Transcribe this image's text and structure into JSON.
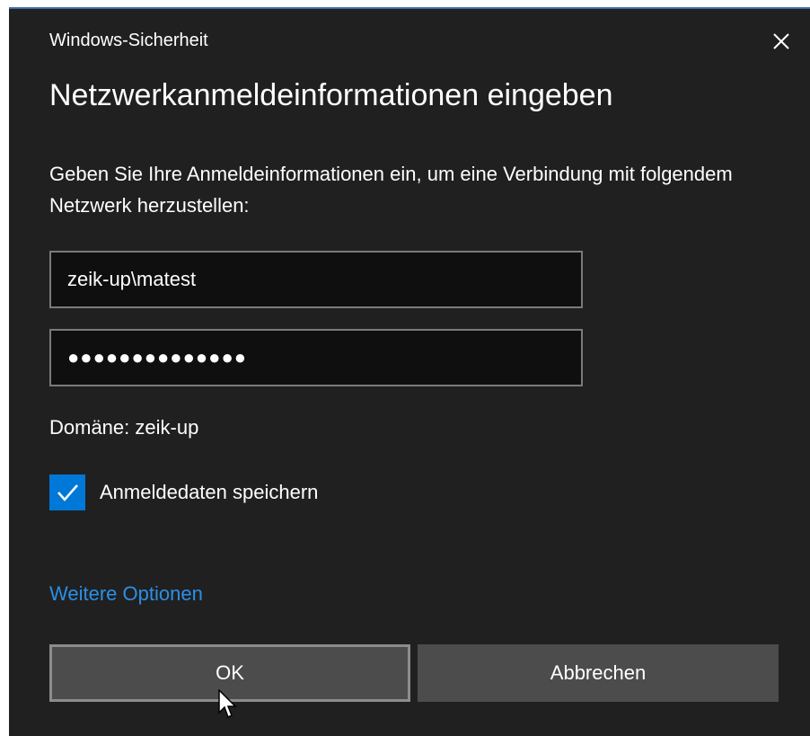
{
  "window": {
    "title": "Windows-Sicherheit",
    "close_icon": "close-icon"
  },
  "dialog": {
    "heading": "Netzwerkanmeldeinformationen eingeben",
    "message": "Geben Sie Ihre Anmeldeinformationen ein, um eine Verbindung mit folgendem Netzwerk herzustellen:"
  },
  "form": {
    "username_value": "zeik-up\\matest",
    "password_masked": "●●●●●●●●●●●●●●",
    "domain_text": "Domäne: zeik-up",
    "remember_label": "Anmeldedaten speichern",
    "remember_checked": true,
    "more_options_label": "Weitere Optionen"
  },
  "buttons": {
    "ok_label": "OK",
    "cancel_label": "Abbrechen"
  },
  "colors": {
    "background": "#202020",
    "accent": "#0078d7",
    "link": "#2b8fe8",
    "button": "#4c4c4c"
  }
}
